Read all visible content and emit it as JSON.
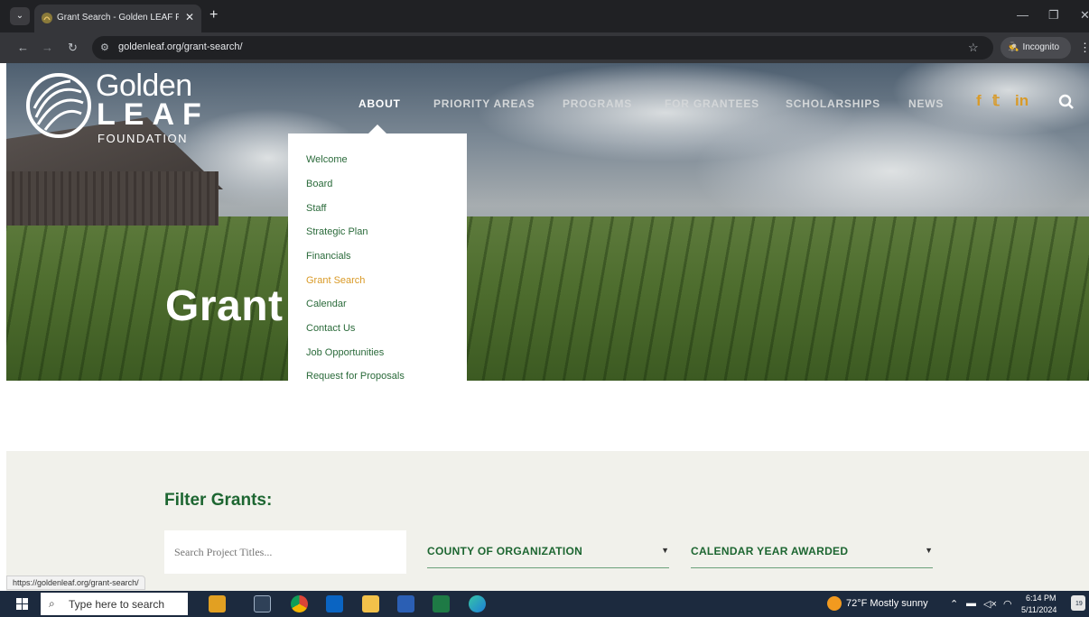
{
  "browser": {
    "tab_title": "Grant Search - Golden LEAF Fo",
    "tab_close": "✕",
    "new_tab": "+",
    "url": "goldenleaf.org/grant-search/",
    "incognito_label": "Incognito",
    "status_url": "https://goldenleaf.org/grant-search/",
    "icons": [
      "tab-menu-icon",
      "back-icon",
      "forward-icon",
      "reload-icon",
      "site-info-icon",
      "star-icon",
      "incognito-icon",
      "menu-icon",
      "minimize-icon",
      "restore-icon",
      "close-icon"
    ]
  },
  "logo": {
    "golden": "Golden",
    "leaf": "LEAF",
    "foundation": "FOUNDATION"
  },
  "nav": {
    "items": [
      "ABOUT",
      "PRIORITY AREAS",
      "PROGRAMS",
      "FOR GRANTEES",
      "SCHOLARSHIPS",
      "NEWS"
    ],
    "active": "ABOUT",
    "social": [
      "f",
      "𝕥",
      "in"
    ],
    "accent_color": "#d99a27"
  },
  "hero": {
    "title": "Grant"
  },
  "dropdown": {
    "items": [
      "Welcome",
      "Board",
      "Staff",
      "Strategic Plan",
      "Financials",
      "Grant Search",
      "Calendar",
      "Contact Us",
      "Job Opportunities",
      "Request for Proposals"
    ],
    "active": "Grant Search"
  },
  "filter": {
    "title": "Filter Grants:",
    "search_placeholder": "Search Project Titles...",
    "county_label": "COUNTY OF ORGANIZATION",
    "year_label": "CALENDAR YEAR AWARDED",
    "brand_color": "#1d6631"
  },
  "taskbar": {
    "search_placeholder": "Type here to search",
    "weather": "72°F  Mostly sunny",
    "time": "6:14 PM",
    "date": "5/11/2024",
    "notification_count": "19",
    "apps": [
      "briefcase-icon",
      "task-view-icon",
      "chrome-icon",
      "outlook-icon",
      "file-explorer-icon",
      "word-icon",
      "excel-icon",
      "edge-icon"
    ]
  }
}
